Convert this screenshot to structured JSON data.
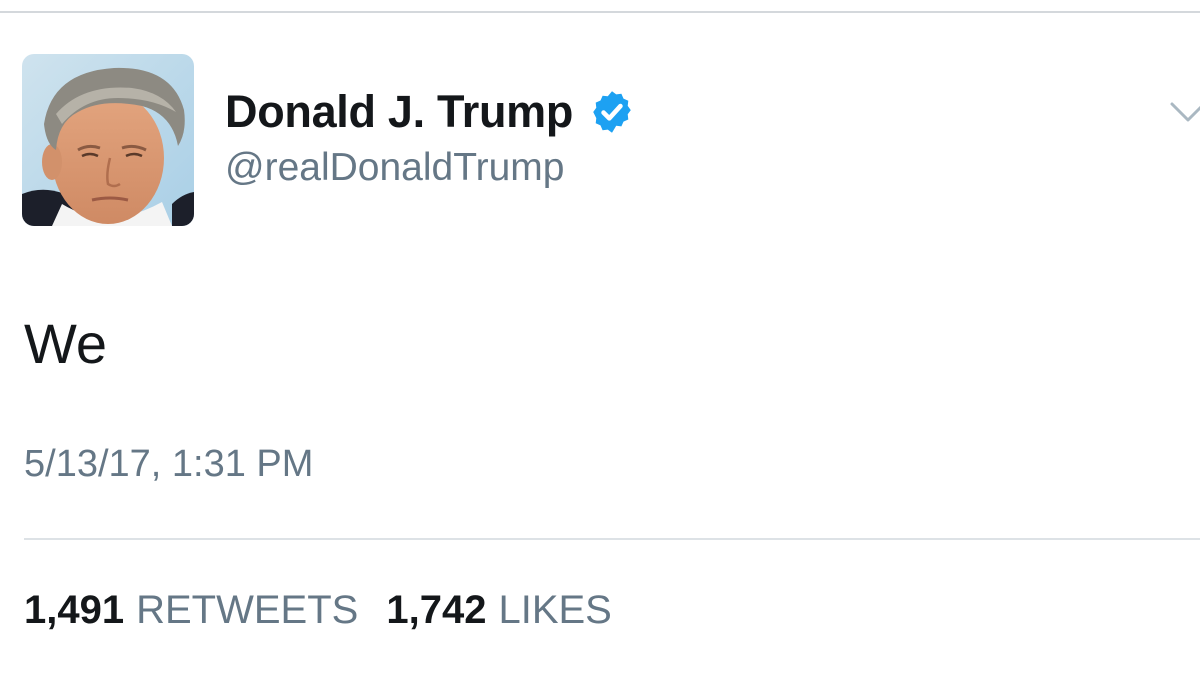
{
  "tweet": {
    "author": {
      "display_name": "Donald J. Trump",
      "handle": "@realDonaldTrump",
      "verified": true
    },
    "text": "We",
    "timestamp": "5/13/17, 1:31 PM",
    "stats": {
      "retweets_count": "1,491",
      "retweets_label": "RETWEETS",
      "likes_count": "1,742",
      "likes_label": "LIKES"
    }
  },
  "icons": {
    "verified": "verified-badge-icon",
    "menu": "chevron-down-icon"
  },
  "colors": {
    "verified_blue": "#1da1f2",
    "secondary_text": "#657786",
    "primary_text": "#14171a"
  }
}
